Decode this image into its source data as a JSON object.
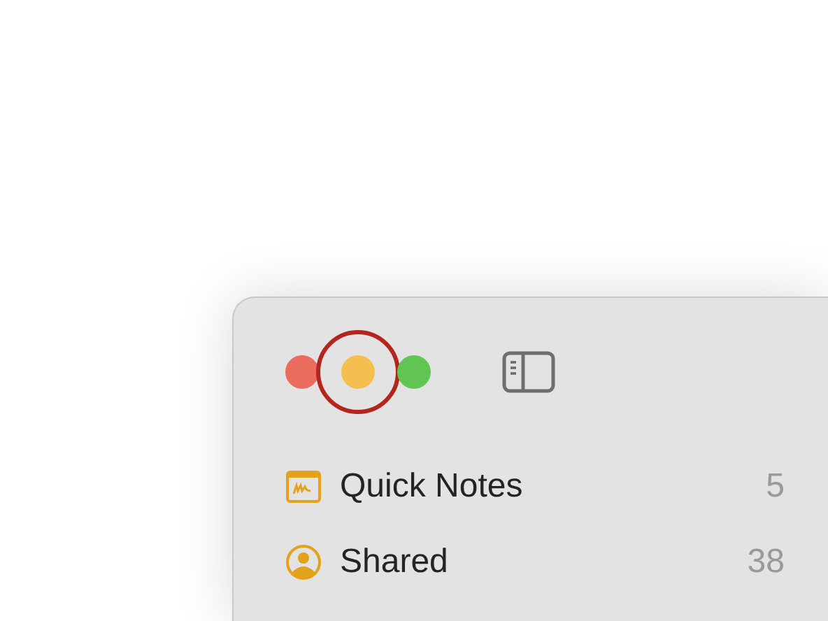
{
  "window": {
    "traffic_lights": [
      {
        "kind": "close",
        "highlighted": false
      },
      {
        "kind": "minimize",
        "highlighted": true
      },
      {
        "kind": "zoom",
        "highlighted": false
      }
    ]
  },
  "sidebar": {
    "items": [
      {
        "kind": "quick-notes",
        "label": "Quick Notes",
        "count": "5"
      },
      {
        "kind": "shared",
        "label": "Shared",
        "count": "38"
      }
    ]
  }
}
